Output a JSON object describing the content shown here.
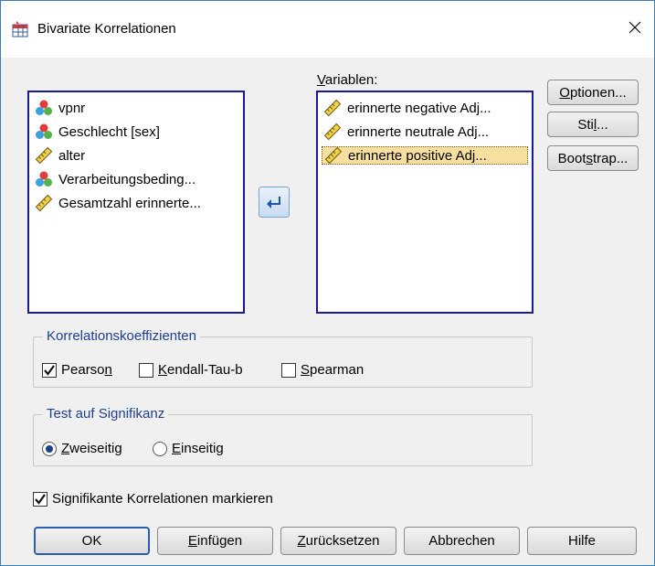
{
  "window": {
    "title": "Bivariate Korrelationen",
    "close_glyph": "×"
  },
  "source_list": {
    "items": [
      {
        "label": "vpnr",
        "icon": "nominal-icon"
      },
      {
        "label": "Geschlecht [sex]",
        "icon": "nominal-icon"
      },
      {
        "label": "alter",
        "icon": "scale-icon"
      },
      {
        "label": "Verarbeitungsbeding...",
        "icon": "nominal-icon"
      },
      {
        "label": "Gesamtzahl erinnerte...",
        "icon": "scale-icon"
      }
    ]
  },
  "target": {
    "label_pre": "",
    "label_accel": "V",
    "label_post": "ariablen:",
    "items": [
      {
        "label": "erinnerte negative Adj...",
        "icon": "scale-icon"
      },
      {
        "label": "erinnerte neutrale Adj...",
        "icon": "scale-icon"
      },
      {
        "label": "erinnerte positive Adj...",
        "icon": "scale-icon",
        "selected": true
      }
    ]
  },
  "side_buttons": {
    "optionen": {
      "pre": "",
      "accel": "O",
      "post": "ptionen..."
    },
    "stil": {
      "pre": "Sti",
      "accel": "l",
      "post": "..."
    },
    "bootstrap": {
      "pre": "Boot",
      "accel": "s",
      "post": "trap..."
    }
  },
  "korrelation": {
    "title": "Korrelationskoeffizienten",
    "pearson": {
      "pre": "Pearso",
      "accel": "n",
      "post": "",
      "checked": true
    },
    "kendall": {
      "pre": "",
      "accel": "K",
      "post": "endall-Tau-b",
      "checked": false
    },
    "spearman": {
      "pre": "",
      "accel": "S",
      "post": "pearman",
      "checked": false
    }
  },
  "signifikanz": {
    "title": "Test auf Signifikanz",
    "zweiseitig": {
      "pre": "",
      "accel": "Z",
      "post": "weiseitig",
      "selected": true
    },
    "einseitig": {
      "pre": "",
      "accel": "E",
      "post": "inseitig",
      "selected": false
    }
  },
  "markieren": {
    "label": "Signifikante Korrelationen markieren",
    "checked": true
  },
  "bottom_buttons": {
    "ok": "OK",
    "einfuegen": {
      "pre": "",
      "accel": "E",
      "post": "infügen"
    },
    "zuruecksetzen": {
      "pre": "",
      "accel": "Z",
      "post": "urücksetzen"
    },
    "abbrechen": "Abbrechen",
    "hilfe": "Hilfe"
  },
  "colors": {
    "accent": "#1a1a99",
    "selection": "#f7dfa0",
    "group_title": "#1f3f8f"
  }
}
